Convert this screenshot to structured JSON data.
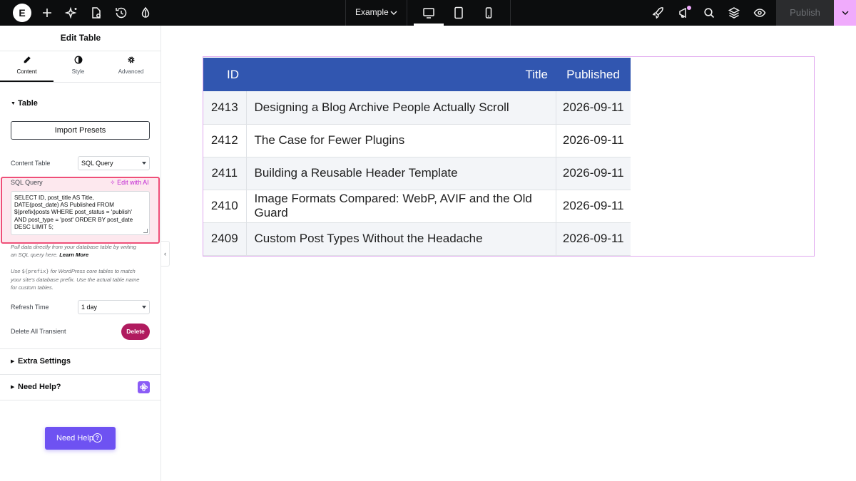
{
  "topbar": {
    "logo_text": "E",
    "page_name": "Example",
    "publish_label": "Publish",
    "icons": [
      "add-icon",
      "sparkle-icon",
      "page-settings-icon",
      "history-icon",
      "theme-style-icon",
      "desktop-icon",
      "tablet-icon",
      "mobile-icon",
      "rocket-icon",
      "notifications-icon",
      "search-icon",
      "navigator-layers-icon",
      "preview-eye-icon",
      "chevron-down-icon"
    ],
    "accent_color": "#f0abfc"
  },
  "panel": {
    "title": "Edit Table",
    "tabs": [
      {
        "label": "Content",
        "icon": "pencil-icon",
        "active": true
      },
      {
        "label": "Style",
        "icon": "half-circle-icon",
        "active": false
      },
      {
        "label": "Advanced",
        "icon": "gear-icon",
        "active": false
      }
    ],
    "section_table": "Table",
    "import_presets": "Import Presets",
    "content_table_label": "Content Table",
    "content_table_value": "SQL Query",
    "sql_label": "SQL Query",
    "edit_with_ai": "Edit with AI",
    "sql_lines": [
      "SELECT ID, post_title AS Title,",
      "DATE(post_date) AS Published FROM",
      "${prefix}posts WHERE post_status = 'publish'",
      "AND post_type = 'post' ORDER BY post_date",
      "DESC LIMIT 5;"
    ],
    "note1_line1": "Pull data directly from your database table by writing",
    "note1_line2": "an SQL query here.",
    "learn_more": "Learn More",
    "note2_use": "Use",
    "note2_code": "${prefix}",
    "note2_rest_line1": "for WordPress core tables to match",
    "note2_line2": "your site's database prefix. Use the actual table name",
    "note2_line3": "for custom tables.",
    "refresh_label": "Refresh Time",
    "refresh_value": "1 day",
    "delete_transient_label": "Delete All Transient",
    "delete_button": "Delete",
    "section_extra": "Extra Settings",
    "section_help": "Need Help?",
    "need_help_button": "Need Help",
    "need_help_icon_glyph": "?",
    "collapse_glyph": "‹"
  },
  "table": {
    "header_color": "#3156b0",
    "columns": [
      "ID",
      "Title",
      "Published"
    ],
    "rows": [
      {
        "id": "2413",
        "title": "Designing a Blog Archive People Actually Scroll",
        "published": "2026-09-11"
      },
      {
        "id": "2412",
        "title": "The Case for Fewer Plugins",
        "published": "2026-09-11"
      },
      {
        "id": "2411",
        "title": "Building a Reusable Header Template",
        "published": "2026-09-11"
      },
      {
        "id": "2410",
        "title": "Image Formats Compared: WebP, AVIF and the Old Guard",
        "published": "2026-09-11"
      },
      {
        "id": "2409",
        "title": "Custom Post Types Without the Headache",
        "published": "2026-09-11"
      }
    ]
  }
}
